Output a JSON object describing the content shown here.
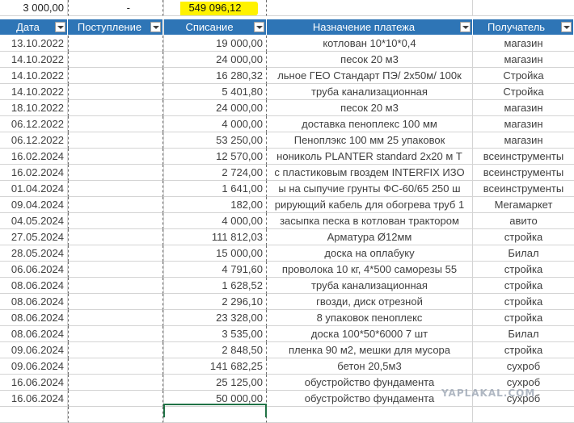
{
  "summary": {
    "income_total": "3 000,00",
    "dash": "-",
    "expense_total": "549 096,12",
    "highlight_color": "#fff200"
  },
  "header": {
    "date": "Дата",
    "income": "Поступление",
    "expense": "Списание",
    "purpose": "Назначение платежа",
    "recipient": "Получатель",
    "header_color": "#2e75b6",
    "filter_icon": "filter-dropdown-icon"
  },
  "rows": [
    {
      "date": "13.10.2022",
      "income": "",
      "expense": "19 000,00",
      "purpose": "котлован 10*10*0,4",
      "recipient": "магазин"
    },
    {
      "date": "14.10.2022",
      "income": "",
      "expense": "24 000,00",
      "purpose": "песок 20 м3",
      "recipient": "магазин"
    },
    {
      "date": "14.10.2022",
      "income": "",
      "expense": "16 280,32",
      "purpose": "льное ГЕО Стандарт ПЭ/ 2х50м/ 100к",
      "recipient": "Стройка"
    },
    {
      "date": "14.10.2022",
      "income": "",
      "expense": "5 401,80",
      "purpose": "труба канализационная",
      "recipient": "Стройка"
    },
    {
      "date": "18.10.2022",
      "income": "",
      "expense": "24 000,00",
      "purpose": "песок 20 м3",
      "recipient": "магазин"
    },
    {
      "date": "06.12.2022",
      "income": "",
      "expense": "4 000,00",
      "purpose": "доставка пеноплекс 100 мм",
      "recipient": "магазин"
    },
    {
      "date": "06.12.2022",
      "income": "",
      "expense": "53 250,00",
      "purpose": "Пеноплэкс 100 мм 25 упаковок",
      "recipient": "магазин"
    },
    {
      "date": "16.02.2024",
      "income": "",
      "expense": "12 570,00",
      "purpose": "нониколь PLANTER standard 2х20 м Т",
      "recipient": "всеинструменты"
    },
    {
      "date": "16.02.2024",
      "income": "",
      "expense": "2 724,00",
      "purpose": "с пластиковым гвоздем INTERFIX ИЗО",
      "recipient": "всеинструменты"
    },
    {
      "date": "01.04.2024",
      "income": "",
      "expense": "1 641,00",
      "purpose": "ы на сыпучие грунты ФС-60/65 250 ш",
      "recipient": "всеинструменты"
    },
    {
      "date": "09.04.2024",
      "income": "",
      "expense": "182,00",
      "purpose": "рирующий кабель для обогрева труб 1",
      "recipient": "Мегамаркет"
    },
    {
      "date": "04.05.2024",
      "income": "",
      "expense": "4 000,00",
      "purpose": "засыпка песка в котлован трактором",
      "recipient": "авито"
    },
    {
      "date": "27.05.2024",
      "income": "",
      "expense": "111 812,03",
      "purpose": "Арматура Ø12мм",
      "recipient": "стройка"
    },
    {
      "date": "28.05.2024",
      "income": "",
      "expense": "15 000,00",
      "purpose": "доска на оплабуку",
      "recipient": "Билал"
    },
    {
      "date": "06.06.2024",
      "income": "",
      "expense": "4 791,60",
      "purpose": "проволока 10 кг, 4*500 саморезы 55",
      "recipient": "стройка"
    },
    {
      "date": "08.06.2024",
      "income": "",
      "expense": "1 628,52",
      "purpose": "труба канализационная",
      "recipient": "стройка"
    },
    {
      "date": "08.06.2024",
      "income": "",
      "expense": "2 296,10",
      "purpose": "гвозди, диск отрезной",
      "recipient": "стройка"
    },
    {
      "date": "08.06.2024",
      "income": "",
      "expense": "23 328,00",
      "purpose": "8 упаковок пеноплекс",
      "recipient": "стройка"
    },
    {
      "date": "08.06.2024",
      "income": "",
      "expense": "3 535,00",
      "purpose": "доска 100*50*6000 7 шт",
      "recipient": "Билал"
    },
    {
      "date": "09.06.2024",
      "income": "",
      "expense": "2 848,50",
      "purpose": "пленка 90 м2, мешки для мусора",
      "recipient": "стройка"
    },
    {
      "date": "09.06.2024",
      "income": "",
      "expense": "141 682,25",
      "purpose": "бетон 20,5м3",
      "recipient": "сухроб"
    },
    {
      "date": "16.06.2024",
      "income": "",
      "expense": "25 125,00",
      "purpose": "обустройство фундамента",
      "recipient": "сухроб"
    },
    {
      "date": "16.06.2024",
      "income": "",
      "expense": "50 000,00",
      "purpose": "обустройство фундамента",
      "recipient": "сухроб"
    }
  ],
  "watermark": "YAPLAKAL.COM"
}
